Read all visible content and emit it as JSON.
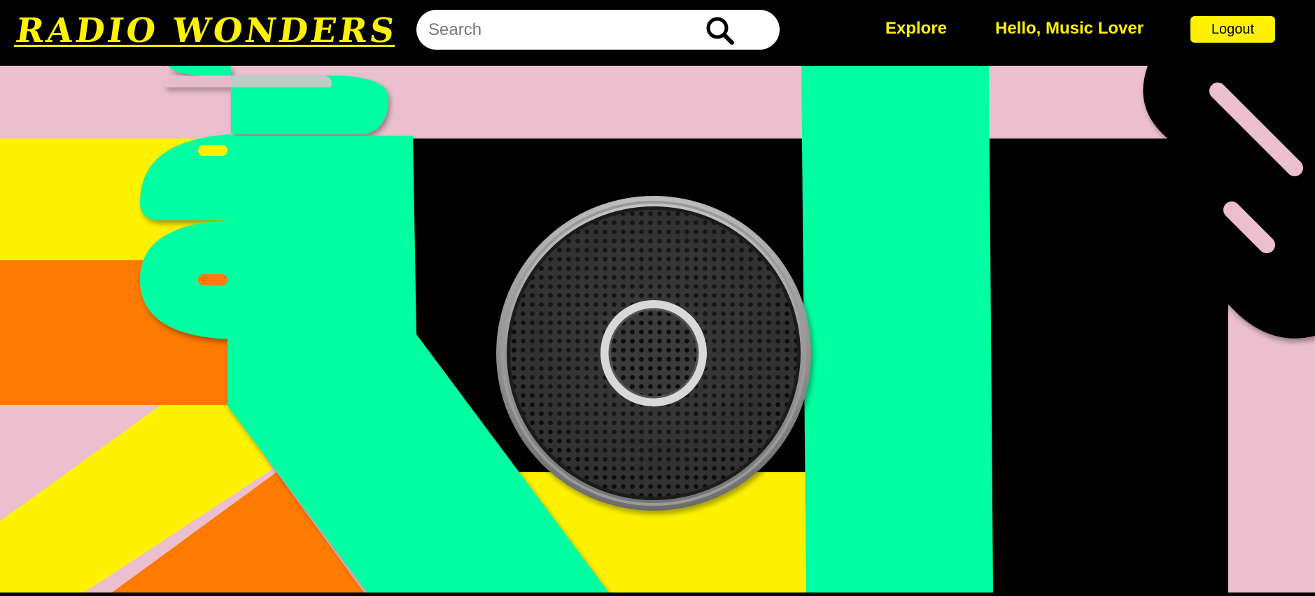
{
  "header": {
    "brand": "RADIO WONDERS",
    "search_placeholder": "Search",
    "nav": {
      "explore": "Explore",
      "greeting": "Hello, Music Lover"
    },
    "logout_label": "Logout"
  },
  "colors": {
    "accent": "#fff200",
    "pink": "#ecbfcf",
    "green": "#00ffa0",
    "orange": "#ff7a00",
    "yellow": "#fff200",
    "black": "#000000"
  },
  "hero": {
    "image": "speaker-grille-collage-illustration"
  }
}
